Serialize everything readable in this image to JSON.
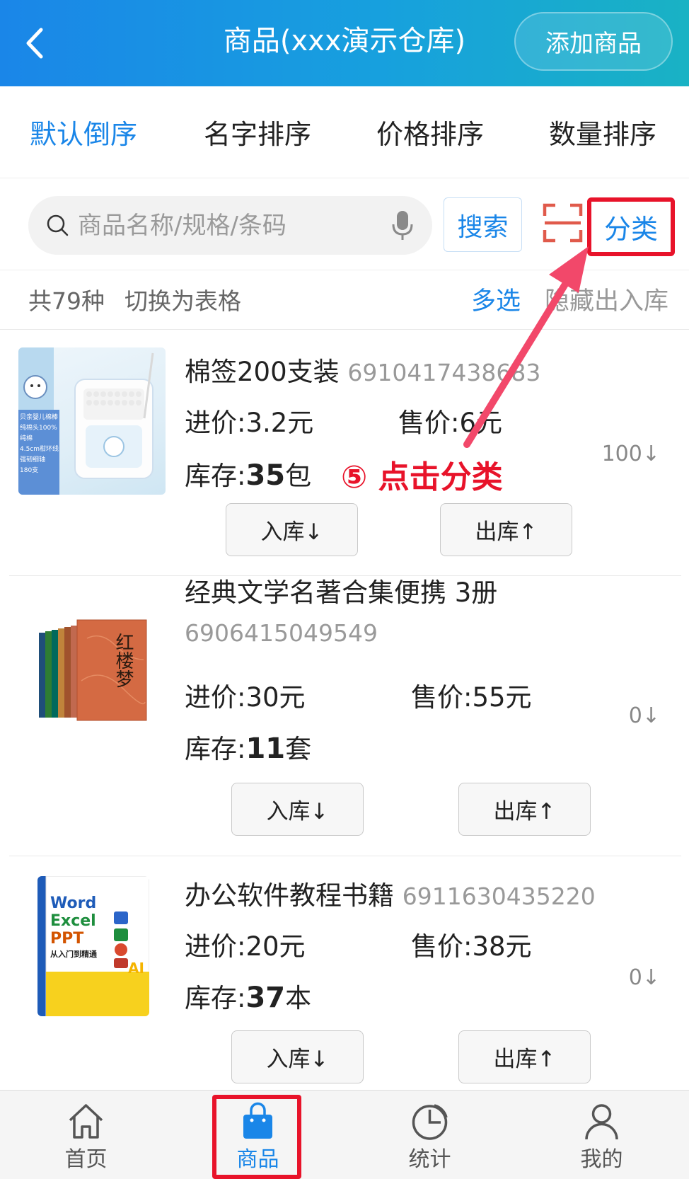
{
  "header": {
    "title": "商品(xxx演示仓库)",
    "add_button": "添加商品"
  },
  "sort_tabs": [
    {
      "label": "默认倒序",
      "active": true
    },
    {
      "label": "名字排序",
      "active": false
    },
    {
      "label": "价格排序",
      "active": false
    },
    {
      "label": "数量排序",
      "active": false
    }
  ],
  "search": {
    "placeholder": "商品名称/规格/条码",
    "button": "搜索",
    "category_button": "分类"
  },
  "info_bar": {
    "count": "共79种",
    "switch_table": "切换为表格",
    "multi_select": "多选",
    "hide_io": "隐藏出入库"
  },
  "labels": {
    "purchase_price": "进价:",
    "sale_price": "售价:",
    "stock": "库存:",
    "in_button": "入库↓",
    "out_button": "出库↑"
  },
  "products": [
    {
      "name": "棉签200支装",
      "code": "6910417438683",
      "purchase_price": "3.2元",
      "sale_price": "6元",
      "stock_qty": "35",
      "stock_unit": "包",
      "flow": "100↓",
      "thumb_text": [
        "贝亲婴儿棉棒",
        "纯棉头100%纯棉",
        "4.5cm柑环线",
        "强韧细轴",
        "180支"
      ]
    },
    {
      "name": "经典文学名著合集便携  3册",
      "code": "6906415049549",
      "purchase_price": "30元",
      "sale_price": "55元",
      "stock_qty": "11",
      "stock_unit": "套",
      "flow": "0↓",
      "thumb_text": [
        "红楼梦"
      ]
    },
    {
      "name": "办公软件教程书籍",
      "code": "6911630435220",
      "purchase_price": "20元",
      "sale_price": "38元",
      "stock_qty": "37",
      "stock_unit": "本",
      "flow": "0↓",
      "thumb_text": [
        "Word",
        "Excel",
        "PPT",
        "从入门到精通",
        "AI"
      ]
    }
  ],
  "annotation": "⑤ 点击分类",
  "tab_bar": [
    {
      "label": "首页",
      "icon": "home-icon",
      "active": false
    },
    {
      "label": "商品",
      "icon": "shopping-bag-icon",
      "active": true
    },
    {
      "label": "统计",
      "icon": "pie-chart-icon",
      "active": false
    },
    {
      "label": "我的",
      "icon": "user-icon",
      "active": false
    }
  ],
  "colors": {
    "primary": "#1a86e8",
    "highlight": "#e8132a",
    "header_start": "#1a86e8",
    "header_end": "#19b2c4"
  }
}
